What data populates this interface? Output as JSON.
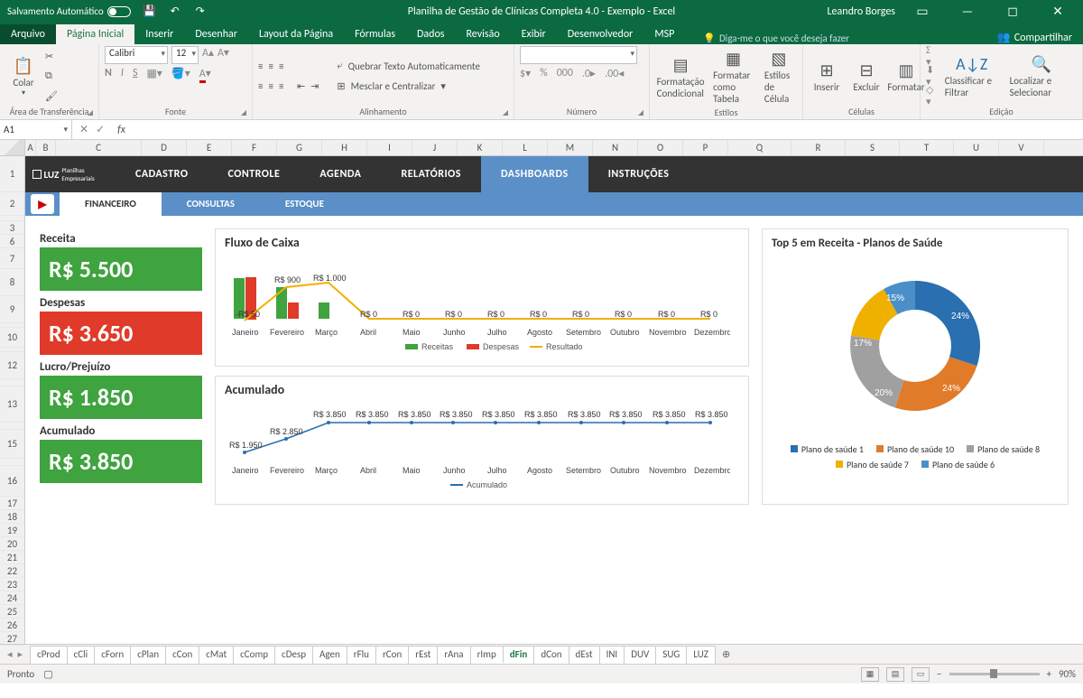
{
  "titlebar": {
    "autosave": "Salvamento Automático",
    "title": "Planilha de Gestão de Clínicas Completa 4.0 - Exemplo  -  Excel",
    "user": "Leandro Borges"
  },
  "ribbon_tabs": {
    "file": "Arquivo",
    "items": [
      "Página Inicial",
      "Inserir",
      "Desenhar",
      "Layout da Página",
      "Fórmulas",
      "Dados",
      "Revisão",
      "Exibir",
      "Desenvolvedor",
      "MSP"
    ],
    "active": "Página Inicial",
    "tell_me": "Diga-me o que você deseja fazer",
    "share": "Compartilhar"
  },
  "ribbon": {
    "clipboard": {
      "paste": "Colar",
      "label": "Área de Transferência"
    },
    "font": {
      "name": "Calibri",
      "size": "12",
      "label": "Fonte",
      "bold": "N",
      "italic": "I",
      "underline": "S"
    },
    "alignment": {
      "wrap": "Quebrar Texto Automaticamente",
      "merge": "Mesclar e Centralizar",
      "label": "Alinhamento"
    },
    "number": {
      "label": "Número",
      "currency": "%",
      "thousands": "000"
    },
    "styles": {
      "cond": "Formatação Condicional",
      "table": "Formatar como Tabela",
      "cell": "Estilos de Célula",
      "label": "Estilos"
    },
    "cells": {
      "insert": "Inserir",
      "delete": "Excluir",
      "format": "Formatar",
      "label": "Células"
    },
    "editing": {
      "sort": "Classificar e Filtrar",
      "find": "Localizar e Selecionar",
      "label": "Edição"
    }
  },
  "namebox": "A1",
  "columns": [
    "A",
    "B",
    "C",
    "D",
    "E",
    "F",
    "G",
    "H",
    "I",
    "J",
    "K",
    "L",
    "M",
    "N",
    "O",
    "P",
    "Q",
    "R",
    "S",
    "T",
    "U",
    "V"
  ],
  "rows": [
    "1",
    "2",
    "",
    "3",
    "6",
    "7",
    "8",
    "9",
    "",
    "10",
    "",
    "12",
    "",
    "13",
    "",
    "15",
    "",
    "16",
    "17",
    "18",
    "19",
    "20",
    "21",
    "22",
    "23",
    "24",
    "25",
    "26",
    "27"
  ],
  "app_nav": {
    "brand": "LUZ",
    "brand_sub": "Planilhas Empresariais",
    "items": [
      "CADASTRO",
      "CONTROLE",
      "AGENDA",
      "RELATÓRIOS",
      "DASHBOARDS",
      "INSTRUÇÕES"
    ],
    "active": "DASHBOARDS"
  },
  "app_sub": {
    "items": [
      "FINANCEIRO",
      "CONSULTAS",
      "ESTOQUE"
    ],
    "active": "FINANCEIRO"
  },
  "kpis": {
    "receita_label": "Receita",
    "receita_value": "R$ 5.500",
    "despesas_label": "Despesas",
    "despesas_value": "R$ 3.650",
    "lucro_label": "Lucro/Prejuízo",
    "lucro_value": "R$ 1.850",
    "acumulado_label": "Acumulado",
    "acumulado_value": "R$ 3.850"
  },
  "months": [
    "Janeiro",
    "Fevereiro",
    "Março",
    "Abril",
    "Maio",
    "Junho",
    "Julho",
    "Agosto",
    "Setembro",
    "Outubro",
    "Novembro",
    "Dezembro"
  ],
  "chart_data": [
    {
      "type": "bar+line",
      "title": "Fluxo de Caixa",
      "x": [
        "Janeiro",
        "Fevereiro",
        "Março",
        "Abril",
        "Maio",
        "Junho",
        "Julho",
        "Agosto",
        "Setembro",
        "Outubro",
        "Novembro",
        "Dezembro"
      ],
      "series": [
        {
          "name": "Receitas",
          "type": "bar",
          "color": "#3fa33f",
          "values": [
            2500,
            2000,
            1000,
            0,
            0,
            0,
            0,
            0,
            0,
            0,
            0,
            0
          ]
        },
        {
          "name": "Despesas",
          "type": "bar",
          "color": "#e03a2a",
          "values": [
            2550,
            1100,
            0,
            0,
            0,
            0,
            0,
            0,
            0,
            0,
            0,
            0
          ]
        },
        {
          "name": "Resultado",
          "type": "line",
          "color": "#f0b000",
          "values": [
            -50,
            900,
            1000,
            0,
            0,
            0,
            0,
            0,
            0,
            0,
            0,
            0
          ]
        }
      ],
      "labels": [
        "-R$ 50",
        "R$ 900",
        "R$ 1.000",
        "R$ 0",
        "R$ 0",
        "R$ 0",
        "R$ 0",
        "R$ 0",
        "R$ 0",
        "R$ 0",
        "R$ 0",
        "R$ 0"
      ],
      "legend": [
        "Receitas",
        "Despesas",
        "Resultado"
      ]
    },
    {
      "type": "line",
      "title": "Acumulado",
      "x": [
        "Janeiro",
        "Fevereiro",
        "Março",
        "Abril",
        "Maio",
        "Junho",
        "Julho",
        "Agosto",
        "Setembro",
        "Outubro",
        "Novembro",
        "Dezembro"
      ],
      "series": [
        {
          "name": "Acumulado",
          "color": "#2a6fb0",
          "values": [
            1950,
            2850,
            3850,
            3850,
            3850,
            3850,
            3850,
            3850,
            3850,
            3850,
            3850,
            3850
          ]
        }
      ],
      "labels": [
        "R$ 1.950",
        "R$ 2.850",
        "R$ 3.850",
        "R$ 3.850",
        "R$ 3.850",
        "R$ 3.850",
        "R$ 3.850",
        "R$ 3.850",
        "R$ 3.850",
        "R$ 3.850",
        "R$ 3.850",
        "R$ 3.850"
      ],
      "legend": [
        "Acumulado"
      ]
    },
    {
      "type": "pie",
      "title": "Top 5 em Receita - Planos de Saúde",
      "series": [
        {
          "name": "Plano de saúde 1",
          "value": 24,
          "color": "#2a6fb0"
        },
        {
          "name": "Plano de saúde 10",
          "value": 24,
          "color": "#e07b2a"
        },
        {
          "name": "Plano de saúde 8",
          "value": 20,
          "color": "#a0a0a0"
        },
        {
          "name": "Plano de saúde 7",
          "value": 17,
          "color": "#f0b000"
        },
        {
          "name": "Plano de saúde 6",
          "value": 15,
          "color": "#4a8fc7"
        }
      ],
      "labels": [
        "24%",
        "24%",
        "20%",
        "17%",
        "15%"
      ]
    }
  ],
  "sheet_tabs": [
    "cProd",
    "cCli",
    "cForn",
    "cPlan",
    "cCon",
    "cMat",
    "cComp",
    "cDesp",
    "Agen",
    "rFlu",
    "rCon",
    "rEst",
    "rAna",
    "rImp",
    "dFin",
    "dCon",
    "dEst",
    "INI",
    "DUV",
    "SUG",
    "LUZ"
  ],
  "active_sheet": "dFin",
  "status": {
    "ready": "Pronto",
    "zoom": "90%"
  }
}
